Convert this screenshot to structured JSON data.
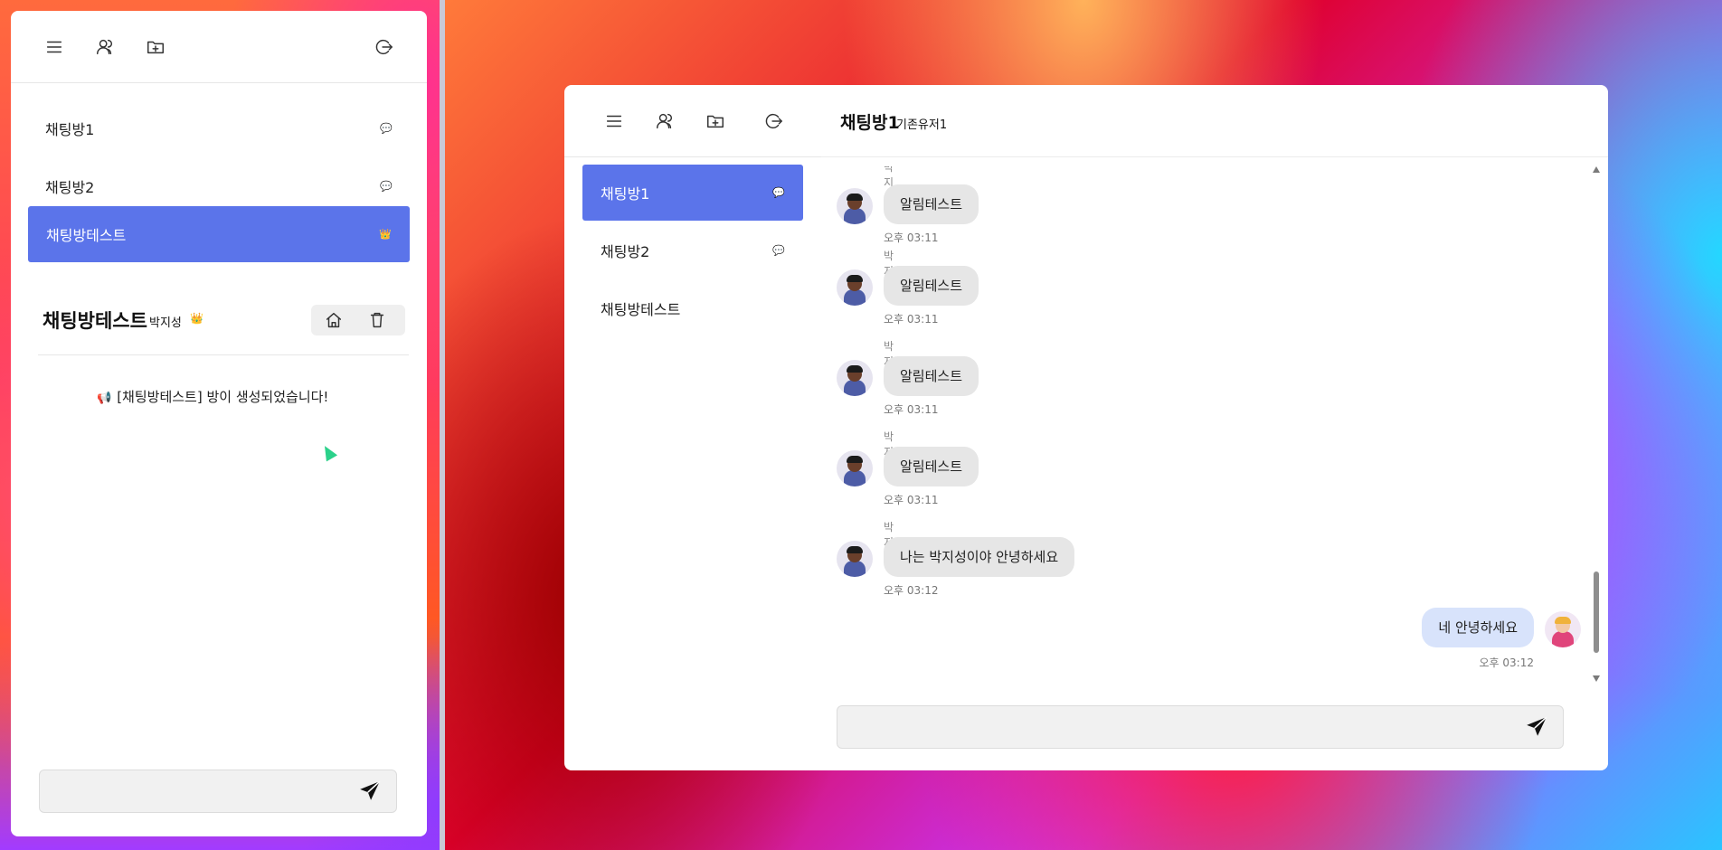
{
  "left_app": {
    "rooms": [
      {
        "label": "채팅방1",
        "badge": "💬",
        "active": false
      },
      {
        "label": "채팅방2",
        "badge": "💬",
        "active": false
      },
      {
        "label": "채팅방테스트",
        "badge": "👑",
        "active": true
      }
    ],
    "channel": {
      "title": "채팅방테스트",
      "user": "박지성",
      "crown": "👑"
    },
    "system_message": "[채팅방테스트] 방이 생성되었습니다!",
    "system_icon": "📢",
    "composer": {
      "value": "",
      "placeholder": ""
    }
  },
  "right_app": {
    "rooms": [
      {
        "label": "채팅방1",
        "badge": "💬",
        "active": true
      },
      {
        "label": "채팅방2",
        "badge": "💬",
        "active": false
      },
      {
        "label": "채팅방테스트",
        "active": false
      }
    ],
    "header": {
      "title": "채팅방1",
      "subtitle": "기존유저1"
    },
    "messages": [
      {
        "sender": "박지성",
        "text": "알림테스트",
        "time": "오후 03:11",
        "mine": false
      },
      {
        "sender": "박지성",
        "text": "알림테스트",
        "time": "오후 03:11",
        "mine": false
      },
      {
        "sender": "박지성",
        "text": "알림테스트",
        "time": "오후 03:11",
        "mine": false
      },
      {
        "sender": "박지성",
        "text": "알림테스트",
        "time": "오후 03:11",
        "mine": false
      },
      {
        "sender": "박지성",
        "text": "나는 박지성이야 안녕하세요",
        "time": "오후 03:12",
        "mine": false
      },
      {
        "sender": "",
        "text": "네 안녕하세요",
        "time": "오후 03:12",
        "mine": true
      }
    ],
    "composer": {
      "value": "",
      "placeholder": ""
    }
  },
  "icons": {
    "menu": "menu-icon",
    "users": "users-icon",
    "new_folder": "folder-plus-icon",
    "logout": "logout-icon",
    "home": "home-icon",
    "trash": "trash-icon",
    "send": "send-icon"
  },
  "colors": {
    "active_room": "#5b74ea",
    "my_bubble": "#d8e3fb",
    "other_bubble": "#e6e6e6"
  }
}
